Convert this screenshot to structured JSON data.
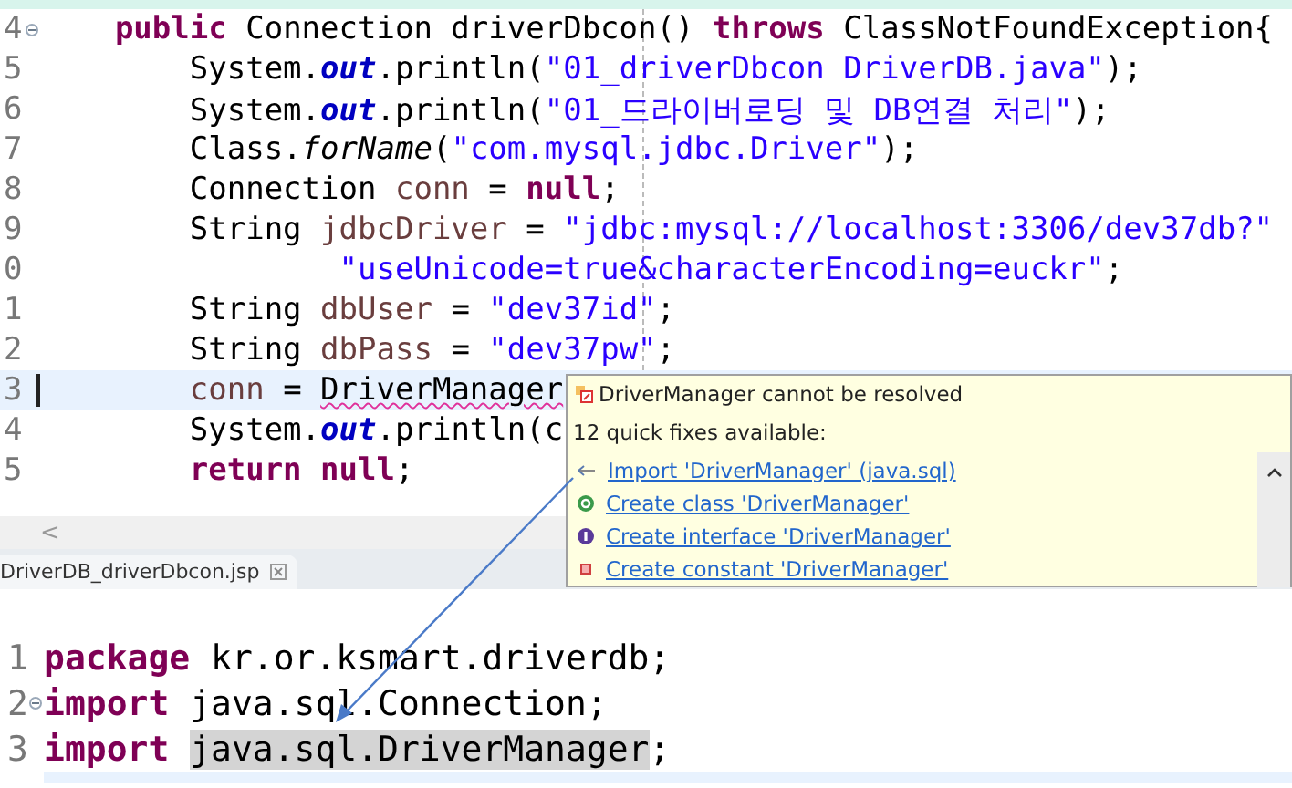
{
  "top_editor": {
    "lines": [
      {
        "number": "4",
        "folding": true,
        "current": false,
        "tokens": [
          {
            "kind": "kw",
            "text": "    public"
          },
          {
            "kind": "txt",
            "text": " Connection driverDbcon() "
          },
          {
            "kind": "kw",
            "text": "throws"
          },
          {
            "kind": "txt",
            "text": " ClassNotFoundException{"
          }
        ]
      },
      {
        "number": "5",
        "folding": false,
        "current": false,
        "tokens": [
          {
            "kind": "txt",
            "text": "        System."
          },
          {
            "kind": "field",
            "text": "out"
          },
          {
            "kind": "txt",
            "text": ".println("
          },
          {
            "kind": "str",
            "text": "\"01_driverDbcon DriverDB.java\""
          },
          {
            "kind": "txt",
            "text": ");"
          }
        ]
      },
      {
        "number": "6",
        "folding": false,
        "current": false,
        "tokens": [
          {
            "kind": "txt",
            "text": "        System."
          },
          {
            "kind": "field",
            "text": "out"
          },
          {
            "kind": "txt",
            "text": ".println("
          },
          {
            "kind": "str",
            "text": "\"01_드라이버로딩 및 DB연결 처리\""
          },
          {
            "kind": "txt",
            "text": ");"
          }
        ]
      },
      {
        "number": "7",
        "folding": false,
        "current": false,
        "tokens": [
          {
            "kind": "txt",
            "text": "        Class."
          },
          {
            "kind": "static",
            "text": "forName"
          },
          {
            "kind": "txt",
            "text": "("
          },
          {
            "kind": "str",
            "text": "\"com.mysql.jdbc.Driver\""
          },
          {
            "kind": "txt",
            "text": ");"
          }
        ]
      },
      {
        "number": "8",
        "folding": false,
        "current": false,
        "tokens": [
          {
            "kind": "txt",
            "text": "        Connection "
          },
          {
            "kind": "var",
            "text": "conn"
          },
          {
            "kind": "txt",
            "text": " = "
          },
          {
            "kind": "kw",
            "text": "null"
          },
          {
            "kind": "txt",
            "text": ";"
          }
        ]
      },
      {
        "number": "9",
        "folding": false,
        "current": false,
        "tokens": [
          {
            "kind": "txt",
            "text": "        String "
          },
          {
            "kind": "var",
            "text": "jdbcDriver"
          },
          {
            "kind": "txt",
            "text": " = "
          },
          {
            "kind": "str",
            "text": "\"jdbc:mysql://localhost:3306/dev37db?\""
          }
        ]
      },
      {
        "number": "0",
        "folding": false,
        "current": false,
        "tokens": [
          {
            "kind": "str",
            "text": "                \"useUnicode=true&characterEncoding=euckr\""
          },
          {
            "kind": "txt",
            "text": ";"
          }
        ]
      },
      {
        "number": "1",
        "folding": false,
        "current": false,
        "tokens": [
          {
            "kind": "txt",
            "text": "        String "
          },
          {
            "kind": "var",
            "text": "dbUser"
          },
          {
            "kind": "txt",
            "text": " = "
          },
          {
            "kind": "str",
            "text": "\"dev37id\""
          },
          {
            "kind": "txt",
            "text": ";"
          }
        ]
      },
      {
        "number": "2",
        "folding": false,
        "current": false,
        "tokens": [
          {
            "kind": "txt",
            "text": "        String "
          },
          {
            "kind": "var",
            "text": "dbPass"
          },
          {
            "kind": "txt",
            "text": " = "
          },
          {
            "kind": "str",
            "text": "\"dev37pw\""
          },
          {
            "kind": "txt",
            "text": ";"
          }
        ]
      },
      {
        "number": "3",
        "folding": false,
        "current": true,
        "tokens": [
          {
            "kind": "var",
            "text": "        conn"
          },
          {
            "kind": "txt",
            "text": " = "
          },
          {
            "kind": "error",
            "text": "DriverManager"
          }
        ]
      },
      {
        "number": "4",
        "folding": false,
        "current": false,
        "tokens": [
          {
            "kind": "txt",
            "text": "        System."
          },
          {
            "kind": "field",
            "text": "out"
          },
          {
            "kind": "txt",
            "text": ".println(c"
          }
        ]
      },
      {
        "number": "5",
        "folding": false,
        "current": false,
        "tokens": [
          {
            "kind": "kw",
            "text": "        return "
          },
          {
            "kind": "kw",
            "text": "null"
          },
          {
            "kind": "txt",
            "text": ";"
          }
        ]
      }
    ]
  },
  "horizontal_scrollbar": {
    "arrow": "<"
  },
  "tab": {
    "label": "DriverDB_driverDbcon.jsp"
  },
  "bottom_editor": {
    "lines": [
      {
        "number": "1",
        "folding": false,
        "current": false,
        "tokens": [
          {
            "kind": "kw",
            "text": "package"
          },
          {
            "kind": "txt",
            "text": " kr.or.ksmart.driverdb;"
          }
        ]
      },
      {
        "number": "2",
        "folding": true,
        "current": false,
        "tokens": [
          {
            "kind": "kw",
            "text": "import"
          },
          {
            "kind": "txt",
            "text": " java.sql.Connection;"
          }
        ]
      },
      {
        "number": "3",
        "folding": false,
        "current": false,
        "tokens": [
          {
            "kind": "kw",
            "text": "import "
          },
          {
            "kind": "occurrence",
            "text": "java.sql.DriverManager"
          },
          {
            "kind": "txt",
            "text": ";"
          }
        ]
      }
    ]
  },
  "quick_fix_popup": {
    "problem": "DriverManager cannot be resolved",
    "summary": "12 quick fixes available:",
    "fixes": [
      {
        "kind": "import",
        "label": "Import 'DriverManager' (java.sql)"
      },
      {
        "kind": "class",
        "label": "Create class 'DriverManager'"
      },
      {
        "kind": "interface",
        "label": "Create interface 'DriverManager'"
      },
      {
        "kind": "constant",
        "label": "Create constant 'DriverManager'"
      }
    ]
  }
}
